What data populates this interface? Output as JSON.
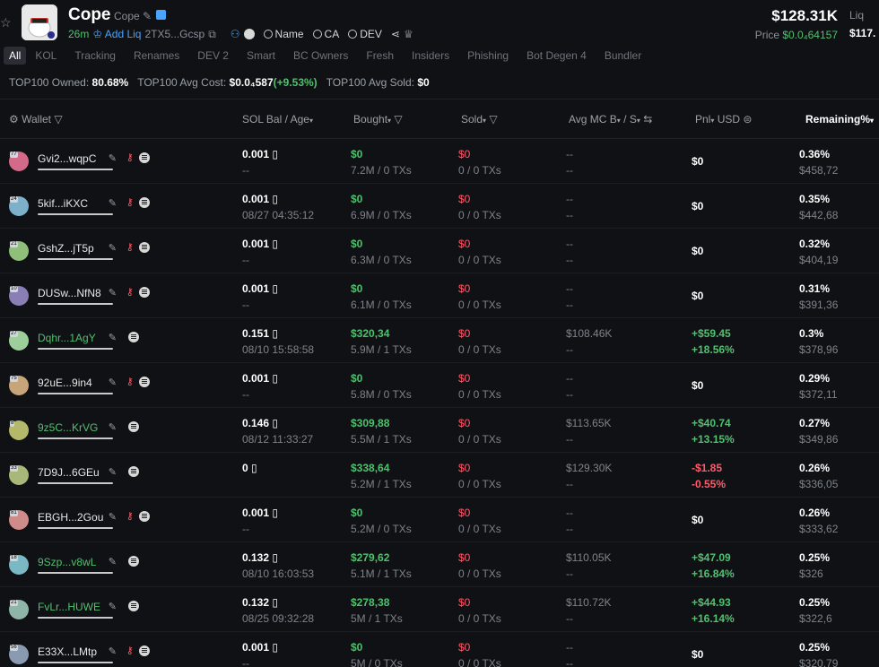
{
  "header": {
    "token_name": "Cope",
    "token_symbol": "Cope",
    "age": "26m",
    "add_liq": "Add Liq",
    "address": "2TX5...Gcsp",
    "links": [
      "Name",
      "CA",
      "DEV"
    ],
    "market_cap": "$128.31K",
    "price_label": "Price",
    "price_value": "$0.0₄64157",
    "liq_label": "Liq",
    "liq_value": "$117."
  },
  "tabs": [
    "All",
    "KOL",
    "Tracking",
    "Renames",
    "DEV 2",
    "Smart",
    "BC Owners",
    "Fresh",
    "Insiders",
    "Phishing",
    "Bot Degen 4",
    "Bundler"
  ],
  "stats": {
    "owned_label": "TOP100 Owned:",
    "owned_value": "80.68%",
    "avg_cost_label": "TOP100 Avg Cost:",
    "avg_cost_value": "$0.0₄587",
    "avg_cost_change": "(+9.53%)",
    "avg_sold_label": "TOP100 Avg Sold:",
    "avg_sold_value": "$0"
  },
  "columns": {
    "wallet": "Wallet",
    "sol_bal": "SOL Bal",
    "age": "/ Age",
    "bought": "Bought",
    "sold": "Sold",
    "avg_mc": "Avg MC B",
    "avg_mc_s": "/ S",
    "pnl": "Pnl",
    "usd": "USD",
    "remaining": "Remaining%"
  },
  "rows": [
    {
      "wallet": "Gvi2...wqpC",
      "green": false,
      "key": true,
      "sol": "0.001",
      "age": "--",
      "bought": "$0",
      "bought_sub": "7.2M / 0 TXs",
      "sold": "$0",
      "sold_sub": "0 / 0 TXs",
      "mc_b": "--",
      "mc_s": "--",
      "pnl": "$0",
      "pnl_pct": "",
      "pnl_type": "zero",
      "rem": "0.36%",
      "rem_sub": "$458,72",
      "badge": "77"
    },
    {
      "wallet": "5kif...iKXC",
      "green": false,
      "key": true,
      "sol": "0.001",
      "age": "08/27 04:35:12",
      "bought": "$0",
      "bought_sub": "6.9M / 0 TXs",
      "sold": "$0",
      "sold_sub": "0 / 0 TXs",
      "mc_b": "--",
      "mc_s": "--",
      "pnl": "$0",
      "pnl_pct": "",
      "pnl_type": "zero",
      "rem": "0.35%",
      "rem_sub": "$442,68",
      "badge": "24"
    },
    {
      "wallet": "GshZ...jT5p",
      "green": false,
      "key": true,
      "sol": "0.001",
      "age": "--",
      "bought": "$0",
      "bought_sub": "6.3M / 0 TXs",
      "sold": "$0",
      "sold_sub": "0 / 0 TXs",
      "mc_b": "--",
      "mc_s": "--",
      "pnl": "$0",
      "pnl_pct": "",
      "pnl_type": "zero",
      "rem": "0.32%",
      "rem_sub": "$404,19",
      "badge": "21"
    },
    {
      "wallet": "DUSw...NfN8",
      "green": false,
      "key": true,
      "sol": "0.001",
      "age": "--",
      "bought": "$0",
      "bought_sub": "6.1M / 0 TXs",
      "sold": "$0",
      "sold_sub": "0 / 0 TXs",
      "mc_b": "--",
      "mc_s": "--",
      "pnl": "$0",
      "pnl_pct": "",
      "pnl_type": "zero",
      "rem": "0.31%",
      "rem_sub": "$391,36",
      "badge": "10"
    },
    {
      "wallet": "Dqhr...1AgY",
      "green": true,
      "key": false,
      "sol": "0.151",
      "age": "08/10 15:58:58",
      "bought": "$320,34",
      "bought_sub": "5.9M / 1 TXs",
      "sold": "$0",
      "sold_sub": "0 / 0 TXs",
      "mc_b": "$108.46K",
      "mc_s": "--",
      "pnl": "+$59.45",
      "pnl_pct": "+18.56%",
      "pnl_type": "pos",
      "rem": "0.3%",
      "rem_sub": "$378,96",
      "badge": "27"
    },
    {
      "wallet": "92uE...9in4",
      "green": false,
      "key": true,
      "sol": "0.001",
      "age": "--",
      "bought": "$0",
      "bought_sub": "5.8M / 0 TXs",
      "sold": "$0",
      "sold_sub": "0 / 0 TXs",
      "mc_b": "--",
      "mc_s": "--",
      "pnl": "$0",
      "pnl_pct": "",
      "pnl_type": "zero",
      "rem": "0.29%",
      "rem_sub": "$372,11",
      "badge": "75"
    },
    {
      "wallet": "9z5C...KrVG",
      "green": true,
      "key": false,
      "sol": "0.146",
      "age": "08/12 11:33:27",
      "bought": "$309,88",
      "bought_sub": "5.5M / 1 TXs",
      "sold": "$0",
      "sold_sub": "0 / 0 TXs",
      "mc_b": "$113.65K",
      "mc_s": "--",
      "pnl": "+$40.74",
      "pnl_pct": "+13.15%",
      "pnl_type": "pos",
      "rem": "0.27%",
      "rem_sub": "$349,86",
      "badge": "8"
    },
    {
      "wallet": "7D9J...6GEu",
      "green": false,
      "key": false,
      "sol": "0",
      "age": "",
      "bought": "$338,64",
      "bought_sub": "5.2M / 1 TXs",
      "sold": "$0",
      "sold_sub": "0 / 0 TXs",
      "mc_b": "$129.30K",
      "mc_s": "--",
      "pnl": "-$1.85",
      "pnl_pct": "-0.55%",
      "pnl_type": "neg",
      "rem": "0.26%",
      "rem_sub": "$336,05",
      "badge": "33"
    },
    {
      "wallet": "EBGH...2Gou",
      "green": false,
      "key": true,
      "sol": "0.001",
      "age": "--",
      "bought": "$0",
      "bought_sub": "5.2M / 0 TXs",
      "sold": "$0",
      "sold_sub": "0 / 0 TXs",
      "mc_b": "--",
      "mc_s": "--",
      "pnl": "$0",
      "pnl_pct": "",
      "pnl_type": "zero",
      "rem": "0.26%",
      "rem_sub": "$333,62",
      "badge": "81"
    },
    {
      "wallet": "9Szp...v8wL",
      "green": true,
      "key": false,
      "sol": "0.132",
      "age": "08/10 16:03:53",
      "bought": "$279,62",
      "bought_sub": "5.1M / 1 TXs",
      "sold": "$0",
      "sold_sub": "0 / 0 TXs",
      "mc_b": "$110.05K",
      "mc_s": "--",
      "pnl": "+$47.09",
      "pnl_pct": "+16.84%",
      "pnl_type": "pos",
      "rem": "0.25%",
      "rem_sub": "$326",
      "badge": "18"
    },
    {
      "wallet": "FvLr...HUWE",
      "green": true,
      "key": false,
      "sol": "0.132",
      "age": "08/25 09:32:28",
      "bought": "$278,38",
      "bought_sub": "5M / 1 TXs",
      "sold": "$0",
      "sold_sub": "0 / 0 TXs",
      "mc_b": "$110.72K",
      "mc_s": "--",
      "pnl": "+$44.93",
      "pnl_pct": "+16.14%",
      "pnl_type": "pos",
      "rem": "0.25%",
      "rem_sub": "$322,6",
      "badge": "21"
    },
    {
      "wallet": "E33X...LMtp",
      "green": false,
      "key": true,
      "sol": "0.001",
      "age": "--",
      "bought": "$0",
      "bought_sub": "5M / 0 TXs",
      "sold": "$0",
      "sold_sub": "0 / 0 TXs",
      "mc_b": "--",
      "mc_s": "--",
      "pnl": "$0",
      "pnl_pct": "",
      "pnl_type": "zero",
      "rem": "0.25%",
      "rem_sub": "$320,79",
      "badge": "56"
    }
  ],
  "colors": {
    "green": "#4fc16f",
    "red": "#ff5a6a",
    "background": "#101114",
    "muted": "#7e838b"
  },
  "icons": [
    "star-icon",
    "edit-icon",
    "verified-icon",
    "crown-icon",
    "copy-icon",
    "user-icon",
    "search-icon",
    "share-icon",
    "gear-icon",
    "filter-icon",
    "sort-icon",
    "swap-icon",
    "key-icon",
    "solana-icon"
  ]
}
